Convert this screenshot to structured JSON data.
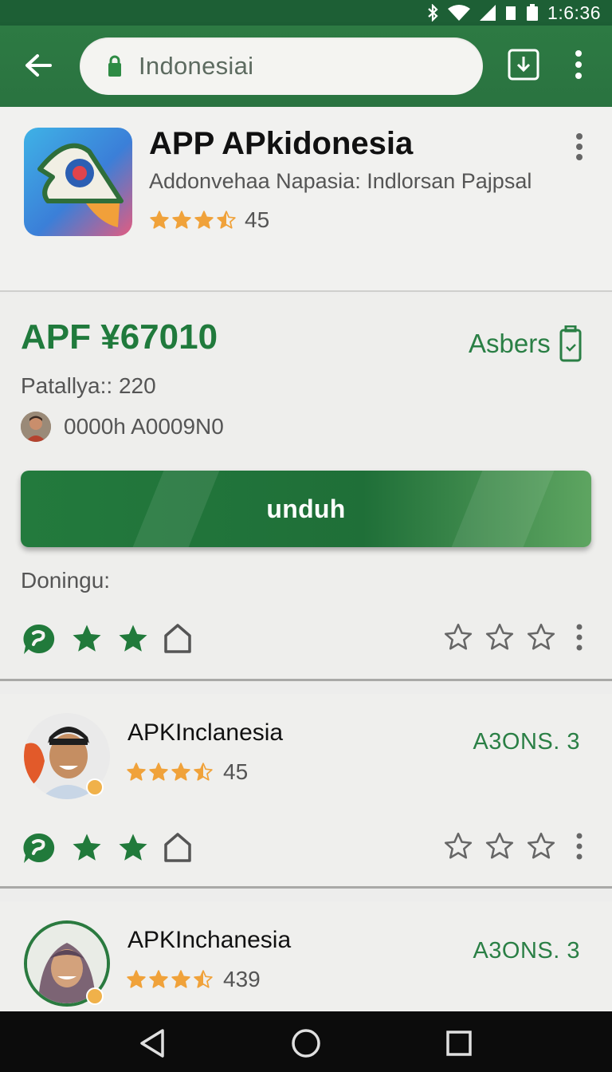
{
  "status_bar": {
    "time": "1:6:36",
    "icons": [
      "bluetooth-icon",
      "wifi-icon",
      "signal-icon",
      "notification-icon",
      "battery-icon"
    ]
  },
  "browser": {
    "url": "Indonesiai"
  },
  "app": {
    "title": "APP APkidonesia",
    "subtitle": "Addonvehaa Napasia: Indlorsan Pajpsal",
    "rating": 3.5,
    "rating_count": "45"
  },
  "details": {
    "price": "APF ¥67010",
    "side_label": "Asbers",
    "meta_line": "Patallya:: 220",
    "author_line": "0000h A0009N0",
    "download_label": "unduh",
    "section_label": "Doningu:"
  },
  "list": [
    {
      "title": "APKInclanesia",
      "rating": 3.5,
      "rating_count": "45",
      "version": "A3ONS. 3"
    },
    {
      "title": "APKInchanesia",
      "rating": 3.5,
      "rating_count": "439",
      "version": "A3ONS. 3"
    }
  ],
  "colors": {
    "brand": "#2a7a3f",
    "status": "#1d5f35",
    "star": "#f0a23a",
    "accent_text": "#2a7f45"
  }
}
